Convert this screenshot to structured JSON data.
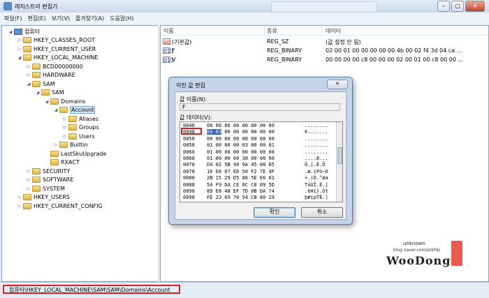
{
  "window": {
    "title": "레지스트리 편집기",
    "blurred_tab": ""
  },
  "menu": [
    "파일(F)",
    "편집(E)",
    "보기(V)",
    "즐겨찾기(A)",
    "도움말(H)"
  ],
  "tree": [
    {
      "label": "컴퓨터",
      "exp": "◢",
      "icon": "pc"
    },
    {
      "label": "HKEY_CLASSES_ROOT",
      "exp": "▷",
      "icon": "folder"
    },
    {
      "label": "HKEY_CURRENT_USER",
      "exp": "▷",
      "icon": "folder"
    },
    {
      "label": "HKEY_LOCAL_MACHINE",
      "exp": "◢",
      "icon": "folder"
    },
    {
      "label": "BCD00000000",
      "exp": "▷",
      "icon": "folder"
    },
    {
      "label": "HARDWARE",
      "exp": "▷",
      "icon": "folder"
    },
    {
      "label": "SAM",
      "exp": "◢",
      "icon": "folder"
    },
    {
      "label": "SAM",
      "exp": "◢",
      "icon": "folder"
    },
    {
      "label": "Domains",
      "exp": "◢",
      "icon": "folder"
    },
    {
      "label": "Account",
      "exp": "◢",
      "icon": "folder",
      "selected": true
    },
    {
      "label": "Aliases",
      "exp": "▷",
      "icon": "folder"
    },
    {
      "label": "Groups",
      "exp": "▷",
      "icon": "folder"
    },
    {
      "label": "Users",
      "exp": "▷",
      "icon": "folder"
    },
    {
      "label": "Builtin",
      "exp": "▷",
      "icon": "folder"
    },
    {
      "label": "LastSkuUpgrade",
      "exp": "",
      "icon": "folder"
    },
    {
      "label": "RXACT",
      "exp": "",
      "icon": "folder"
    },
    {
      "label": "SECURITY",
      "exp": "▷",
      "icon": "folder"
    },
    {
      "label": "SOFTWARE",
      "exp": "▷",
      "icon": "folder"
    },
    {
      "label": "SYSTEM",
      "exp": "▷",
      "icon": "folder"
    },
    {
      "label": "HKEY_USERS",
      "exp": "▷",
      "icon": "folder"
    },
    {
      "label": "HKEY_CURRENT_CONFIG",
      "exp": "▷",
      "icon": "folder"
    }
  ],
  "list": {
    "columns": [
      "이름",
      "종류",
      "데이터"
    ],
    "rows": [
      {
        "icon": "ab",
        "name": "(기본값)",
        "type": "REG_SZ",
        "data": "(값 설정 안 됨)"
      },
      {
        "icon": "bin",
        "name": "F",
        "type": "REG_BINARY",
        "data": "02 00 01 00 00 00 00 00 4b 00 02 f4 3d 04 ca ..."
      },
      {
        "icon": "bin",
        "name": "V",
        "type": "REG_BINARY",
        "data": "00 00 00 00 c8 00 00 00 02 00 01 00 c8 00 00 ..."
      }
    ]
  },
  "dialog": {
    "title": "이진 값 편집",
    "close": "✕",
    "name_label": "값 이름(N):",
    "name_value": "F",
    "data_label": "값 데이터(V):",
    "hex": [
      {
        "off": "0040",
        "pre": "",
        "hl": "",
        "bytes": "00 00 00 00 00 00 00 00",
        "asc": "........"
      },
      {
        "off": "0048",
        "pre": "",
        "hl": "EA 03",
        "bytes": " 00 00 00 00 00 00",
        "asc": "ê......."
      },
      {
        "off": "0050",
        "pre": "",
        "hl": "",
        "bytes": "00 00 00 00 00 00 00 00",
        "asc": "........"
      },
      {
        "off": "0058",
        "pre": "",
        "hl": "",
        "bytes": "01 00 00 00 03 00 00 01",
        "asc": "........"
      },
      {
        "off": "0060",
        "pre": "",
        "hl": "",
        "bytes": "01 00 00 00 00 00 00 00",
        "asc": "........"
      },
      {
        "off": "0068",
        "pre": "",
        "hl": "",
        "bytes": "01 00 00 00 38 00 00 00",
        "asc": "....8..."
      },
      {
        "off": "0070",
        "pre": "",
        "hl": "",
        "bytes": "D4 02 5B 90 9A 45 08 D5",
        "asc": "Ô.[.É.Õ"
      },
      {
        "off": "0078",
        "pre": "",
        "hl": "",
        "bytes": "16 E6 07 ED 50 F2 7E 4F",
        "asc": ".æ.íPò~O"
      },
      {
        "off": "0080",
        "pre": "",
        "hl": "",
        "bytes": "2B 15 29 D5 86 5E E6 61",
        "asc": "+.)Õ.^æa"
      },
      {
        "off": "0088",
        "pre": "",
        "hl": "",
        "bytes": "54 F9 DA CE 0C C8 09 5D",
        "asc": "TùÚÎ.È.]"
      },
      {
        "off": "0090",
        "pre": "",
        "hl": "",
        "bytes": "89 E8 48 EF 7D 0B DA 74",
        "asc": ".èHï}.Út"
      },
      {
        "off": "0098",
        "pre": "",
        "hl": "",
        "bytes": "FE 23 69 70 54 CB 80 29",
        "asc": "þ#ipTË.)"
      }
    ],
    "ok": "확인",
    "cancel": "취소"
  },
  "status": {
    "path": "컴퓨터\\HKEY_LOCAL_MACHINE\\SAM\\SAM\\Domains\\Account"
  },
  "watermark": {
    "small": "unknown",
    "blog": "blog.naver.com/szkfds",
    "name": "WooDong"
  }
}
